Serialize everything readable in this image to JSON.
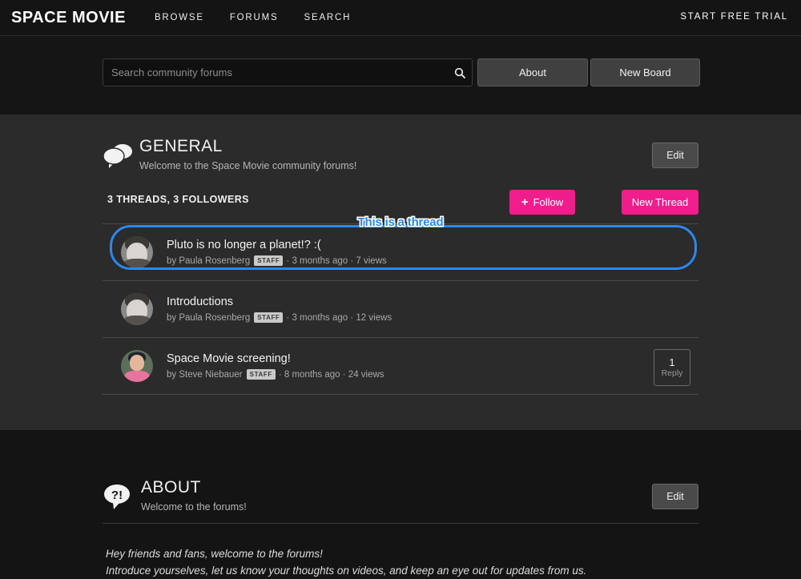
{
  "topnav": {
    "brand": "SPACE MOVIE",
    "links": [
      {
        "label": "BROWSE"
      },
      {
        "label": "FORUMS"
      },
      {
        "label": "SEARCH"
      }
    ],
    "cta": "START FREE TRIAL"
  },
  "searchbar": {
    "placeholder": "Search community forums",
    "value": "",
    "search_icon": "search-icon",
    "about_button": "About",
    "new_board_button": "New Board"
  },
  "board": {
    "icon": "chat-bubbles-icon",
    "title": "GENERAL",
    "subtitle": "Welcome to the Space Movie community forums!",
    "edit_label": "Edit",
    "stats": "3 THREADS, 3 FOLLOWERS",
    "follow_label": "Follow",
    "follow_icon": "plus-icon",
    "new_thread_label": "New Thread",
    "threads": [
      {
        "title": "Pluto is no longer a planet!? :(",
        "by_prefix": "by",
        "author": "Paula Rosenberg",
        "badge": "STAFF",
        "age": "3 months ago",
        "views": "7 views",
        "separator": "·",
        "avatar": "avatar-paula-rosenberg",
        "replies": null
      },
      {
        "title": "Introductions",
        "by_prefix": "by",
        "author": "Paula Rosenberg",
        "badge": "STAFF",
        "age": "3 months ago",
        "views": "12 views",
        "separator": "·",
        "avatar": "avatar-paula-rosenberg",
        "replies": null
      },
      {
        "title": "Space Movie screening!",
        "by_prefix": "by",
        "author": "Steve Niebauer",
        "badge": "STAFF",
        "age": "8 months ago",
        "views": "24 views",
        "separator": "·",
        "avatar": "avatar-steve-niebauer",
        "replies": {
          "count": "1",
          "label": "Reply"
        }
      }
    ]
  },
  "annotation": {
    "label": "This is a thread",
    "color": "#2b88ee"
  },
  "about": {
    "icon": "question-exclamation-bubble-icon",
    "title": "ABOUT",
    "subtitle": "Welcome to the forums!",
    "edit_label": "Edit",
    "body_line1": "Hey friends and fans, welcome to the forums!",
    "body_line2": "Introduce yourselves, let us know your thoughts on videos, and keep an eye out for updates from us."
  },
  "colors": {
    "accent_pink": "#f01e8c",
    "highlight_blue": "#2b88ee",
    "nav_background": "#141414",
    "forum_background": "#2b2b2b"
  }
}
